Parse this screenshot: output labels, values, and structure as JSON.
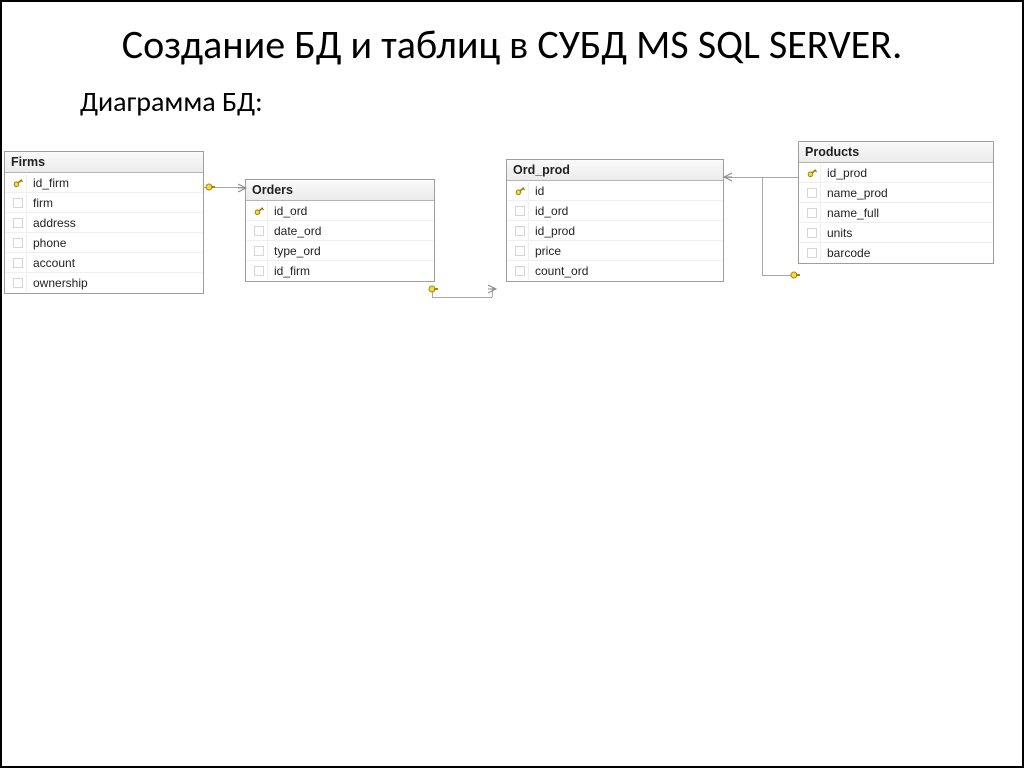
{
  "title": "Создание БД и таблиц в СУБД MS SQL SERVER.",
  "subheading": "Диаграмма БД:",
  "entities": {
    "firms": {
      "name": "Firms",
      "fields": [
        {
          "key": true,
          "name": "id_firm"
        },
        {
          "key": false,
          "name": "firm"
        },
        {
          "key": false,
          "name": "address"
        },
        {
          "key": false,
          "name": "phone"
        },
        {
          "key": false,
          "name": "account"
        },
        {
          "key": false,
          "name": "ownership"
        }
      ]
    },
    "orders": {
      "name": "Orders",
      "fields": [
        {
          "key": true,
          "name": "id_ord"
        },
        {
          "key": false,
          "name": "date_ord"
        },
        {
          "key": false,
          "name": "type_ord"
        },
        {
          "key": false,
          "name": "id_firm"
        }
      ]
    },
    "ord_prod": {
      "name": "Ord_prod",
      "fields": [
        {
          "key": true,
          "name": "id"
        },
        {
          "key": false,
          "name": "id_ord"
        },
        {
          "key": false,
          "name": "id_prod"
        },
        {
          "key": false,
          "name": "price"
        },
        {
          "key": false,
          "name": "count_ord"
        }
      ]
    },
    "products": {
      "name": "Products",
      "fields": [
        {
          "key": true,
          "name": "id_prod"
        },
        {
          "key": false,
          "name": "name_prod"
        },
        {
          "key": false,
          "name": "name_full"
        },
        {
          "key": false,
          "name": "units"
        },
        {
          "key": false,
          "name": "barcode"
        }
      ]
    }
  },
  "relationships": [
    {
      "from": "Firms.id_firm",
      "to": "Orders.id_firm"
    },
    {
      "from": "Orders.id_ord",
      "to": "Ord_prod.id_ord"
    },
    {
      "from": "Products.id_prod",
      "to": "Ord_prod.id_prod"
    }
  ]
}
